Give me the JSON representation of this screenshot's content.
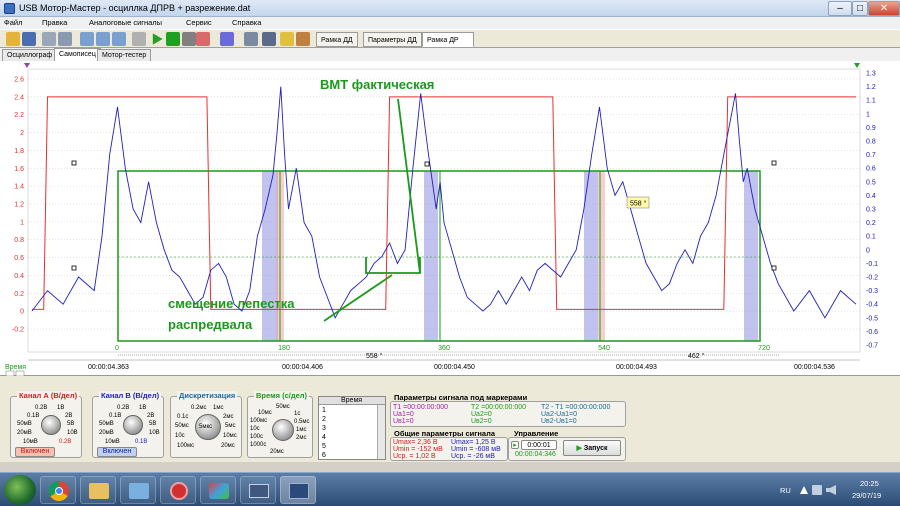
{
  "window": {
    "title": "USB Мотор-Мастер - осциллка ДПРВ + разрежение.dat",
    "min": "–",
    "max": "□",
    "close": "✕"
  },
  "menu": [
    "Файл",
    "Правка",
    "Аналоговые сигналы",
    "Сервис",
    "Справка"
  ],
  "toolbar_tabs": [
    "Рамка ДД",
    "Параметры ДД",
    "Рамка ДР"
  ],
  "tabs": [
    "Осциллограф",
    "Самописец",
    "Мотор-тестер"
  ],
  "plot": {
    "left_ticks": [
      "2.6",
      "2.4",
      "2.2",
      "2",
      "1.8",
      "1.6",
      "1.4",
      "1.2",
      "1",
      "0.8",
      "0.6",
      "0.4",
      "0.2",
      "0",
      "-0.2"
    ],
    "right_ticks": [
      "1.3",
      "1.2",
      "1.1",
      "1",
      "0.9",
      "0.8",
      "0.7",
      "0.6",
      "0.5",
      "0.4",
      "0.3",
      "0.2",
      "0.1",
      "0",
      "-0.1",
      "-0.2",
      "-0.3",
      "-0.4",
      "-0.5",
      "-0.6",
      "-0.7"
    ],
    "degree_ticks": [
      "0",
      "180",
      "360",
      "540",
      "720"
    ],
    "spans": [
      "558 °",
      "462 °"
    ],
    "marker_label": "558 °",
    "annotation_top": "ВМТ фактическая",
    "annotation_bottom_1": "смещение лепестка",
    "annotation_bottom_2": "распредвала",
    "time_label": "Время",
    "time_ticks": [
      "00:00:04.363",
      "00:00:04.406",
      "00:00:04.450",
      "00:00:04.493",
      "00:00:04.536"
    ],
    "colors": {
      "ch_a": "#e83030",
      "ch_b": "#2020c0",
      "frame": "#1a9a1a",
      "grid": "#c8c8c8"
    }
  },
  "chart_data": {
    "type": "line",
    "x_unit": "degrees",
    "series": [
      {
        "name": "Канал A",
        "color": "#e83030",
        "axis": "left",
        "x": [
          0,
          15,
          20,
          225,
          230,
          455,
          460,
          670,
          675,
          890,
          895,
          1060
        ],
        "y": [
          0.02,
          0.02,
          2.4,
          2.4,
          0.02,
          0.02,
          2.4,
          2.4,
          0.02,
          0.02,
          2.4,
          2.4
        ]
      },
      {
        "name": "Канал B",
        "color": "#2020c0",
        "axis": "right",
        "x": [
          0,
          20,
          40,
          60,
          80,
          90,
          100,
          110,
          120,
          130,
          140,
          150,
          160,
          170,
          180,
          190,
          200,
          210,
          220,
          230,
          240,
          250,
          260,
          270,
          280,
          290,
          300,
          310,
          315,
          320,
          325,
          330,
          340,
          350,
          360,
          370,
          380,
          390,
          400,
          410,
          420,
          430,
          440,
          450,
          460,
          470,
          480,
          490,
          500,
          510,
          520,
          525,
          530,
          540,
          550,
          560,
          570,
          580,
          590,
          600,
          610,
          620,
          630,
          640,
          650,
          660,
          680,
          700,
          710,
          720,
          730,
          740,
          750,
          760,
          770,
          780,
          790,
          800,
          810,
          820,
          830,
          840,
          850,
          860,
          870,
          880,
          890,
          900,
          905,
          910,
          915,
          920,
          930,
          940,
          950,
          960,
          980,
          1000,
          1020,
          1040,
          1060
        ],
        "y": [
          -0.45,
          -0.3,
          -0.4,
          -0.2,
          -0.3,
          0.1,
          0.7,
          1.05,
          0.6,
          0.3,
          0.2,
          0.5,
          0.2,
          0.0,
          -0.15,
          -0.2,
          -0.3,
          -0.4,
          -0.35,
          -0.15,
          -0.1,
          -0.2,
          -0.4,
          -0.45,
          -0.3,
          0.1,
          0.3,
          0.55,
          0.85,
          1.2,
          0.7,
          0.3,
          0.6,
          0.2,
          0.1,
          -0.2,
          -0.35,
          -0.5,
          -0.4,
          -0.3,
          -0.25,
          -0.2,
          -0.1,
          -0.05,
          0.05,
          -0.1,
          0.0,
          0.6,
          1.15,
          0.7,
          0.3,
          0.5,
          0.2,
          0.0,
          -0.2,
          -0.35,
          -0.4,
          -0.45,
          -0.4,
          -0.3,
          -0.4,
          -0.3,
          -0.2,
          -0.3,
          -0.15,
          -0.1,
          -0.2,
          0.0,
          0.3,
          0.7,
          1.05,
          0.6,
          0.4,
          0.5,
          0.3,
          0.1,
          -0.1,
          -0.2,
          -0.3,
          -0.25,
          -0.1,
          0.0,
          -0.1,
          0.1,
          0.2,
          0.4,
          0.7,
          1.0,
          1.15,
          0.8,
          0.5,
          0.6,
          0.3,
          0.1,
          -0.1,
          -0.25,
          -0.45,
          -0.3,
          -0.5,
          -0.3,
          -0.4
        ]
      }
    ]
  },
  "controls": {
    "channel_a": {
      "title": "Канал А (В/дел)",
      "values": [
        "0.2В",
        "1В",
        "0.1В",
        "2В",
        "50мВ",
        "5В",
        "20мВ",
        "10В",
        "10мВ",
        "20В"
      ],
      "selected": "0.2В",
      "button": "Включен"
    },
    "channel_b": {
      "title": "Канал В (В/дел)",
      "values": [
        "0.2В",
        "1В",
        "0.1В",
        "2В",
        "50мВ",
        "5В",
        "20мВ",
        "10В",
        "10мВ",
        "20В"
      ],
      "selected": "0.1В",
      "button": "Включен"
    },
    "discretization": {
      "title": "Дискретизация",
      "values": [
        "0.2мс",
        "1мс",
        "0.1с",
        "2мс",
        "50мс",
        "5мс",
        "10с",
        "10мс",
        "100мс",
        "20мс"
      ],
      "center": "5мкс"
    },
    "time": {
      "title": "Время (с/дел)",
      "values": [
        "50мс",
        "10мс",
        "100мс",
        "1с",
        "0.5мс",
        "10с",
        "1мс",
        "100с",
        "2мс",
        "1000с",
        "20мс"
      ]
    }
  },
  "markers_table": {
    "header": "Время",
    "rows": [
      "1",
      "2",
      "3",
      "4",
      "5",
      "6"
    ]
  },
  "params": {
    "title": "Параметры сигнала под маркерами",
    "t1": "T1 =00:00:00:000",
    "t2": "T2 =00:00:00:000",
    "t2t1": "T2 - T1 =00:00:00:000",
    "ua1": "Uа1=0",
    "ub1": "Uв1=0",
    "ua2": "Uа2=0",
    "ub2": "Uв2=0",
    "dua": "Uа2-Uа1=0",
    "dub": "Uв2-Uв1=0"
  },
  "general": {
    "title": "Общие параметры сигнала",
    "a_max": "Umax= 2,36 В",
    "a_min": "Umin = -152 мВ",
    "a_avg": "Uср. = 1,02 В",
    "b_max": "Umax= 1,25 В",
    "b_min": "Umin = -608 мВ",
    "b_avg": "Uср. = -26 мВ"
  },
  "control": {
    "title": "Управление",
    "time_value": "0:00:01",
    "elapsed": "00:00:04:346",
    "start": "Запуск"
  },
  "taskbar": {
    "lang": "RU",
    "time": "20:25",
    "date": "29/07/19"
  }
}
